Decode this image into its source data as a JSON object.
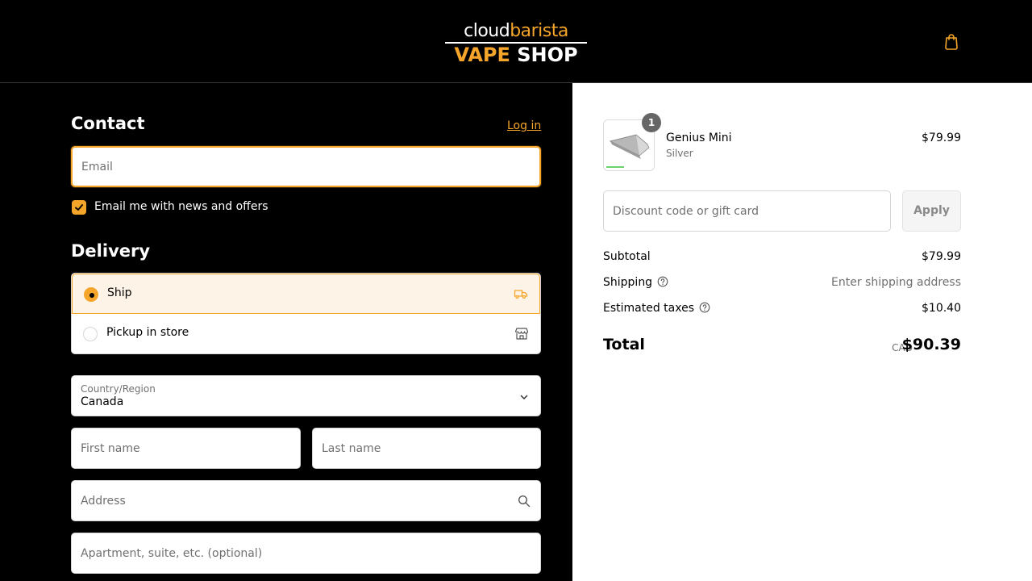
{
  "header": {
    "logo_top_a": "cloud",
    "logo_top_b": "barista",
    "logo_bottom_a": "VAPE",
    "logo_bottom_b": "SHOP",
    "cart_icon": "shopping-bag-icon"
  },
  "contact": {
    "heading": "Contact",
    "login_link": "Log in",
    "email_placeholder": "Email",
    "newsletter_label": "Email me with news and offers",
    "newsletter_checked": true
  },
  "delivery": {
    "heading": "Delivery",
    "options": [
      {
        "label": "Ship",
        "selected": true,
        "icon": "truck-icon"
      },
      {
        "label": "Pickup in store",
        "selected": false,
        "icon": "store-icon"
      }
    ],
    "country_label": "Country/Region",
    "country_value": "Canada",
    "first_name_placeholder": "First name",
    "last_name_placeholder": "Last name",
    "address_placeholder": "Address",
    "apartment_placeholder": "Apartment, suite, etc. (optional)"
  },
  "summary": {
    "item": {
      "quantity": "1",
      "name": "Genius Mini",
      "variant": "Silver",
      "price": "$79.99"
    },
    "discount_placeholder": "Discount code or gift card",
    "apply_label": "Apply",
    "subtotal_label": "Subtotal",
    "subtotal_value": "$79.99",
    "shipping_label": "Shipping",
    "shipping_value": "Enter shipping address",
    "taxes_label": "Estimated taxes",
    "taxes_value": "$10.40",
    "total_label": "Total",
    "total_currency": "CAD",
    "total_value": "$90.39"
  },
  "colors": {
    "accent": "#f5a62a",
    "background": "#000000",
    "summary_bg": "#ffffff"
  }
}
